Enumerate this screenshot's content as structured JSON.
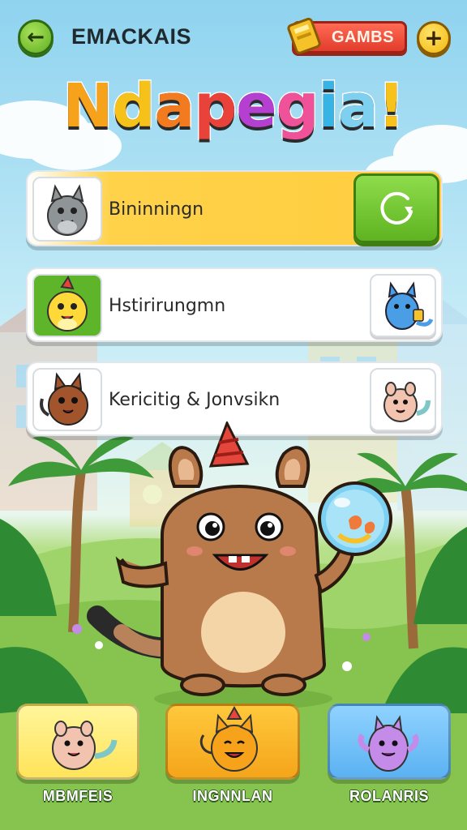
{
  "header": {
    "title": "EMACKAIS",
    "currency_label": "GAMBS",
    "back_icon": "back-arrow-icon",
    "plus_icon": "plus-icon",
    "ticket_icon": "ticket-icon"
  },
  "logo": {
    "letters": [
      "N",
      "d",
      "a",
      "p",
      "e",
      "g",
      "i",
      "a",
      "!"
    ],
    "colors": [
      "#f7a21b",
      "#f6c21a",
      "#f27a1f",
      "#e8423b",
      "#b43fd1",
      "#f0529a",
      "#36b4e6",
      "#7ed0f0",
      "#f7c21b"
    ]
  },
  "cards": [
    {
      "title": "Bininningn",
      "avatar": "gray-creature-avatar",
      "action_icon": "play-circle-icon"
    },
    {
      "title": "Hstirirungmn",
      "avatar": "yellow-creature-avatar",
      "side_avatar": "blue-creature-avatar"
    },
    {
      "title": "Kericitig & Jonvsikn",
      "avatar": "brown-creature-avatar",
      "side_avatar": "pink-creature-avatar"
    }
  ],
  "bottom_nav": [
    {
      "label": "MBMFEIS",
      "icon": "pink-critter-icon"
    },
    {
      "label": "INGNNLAN",
      "icon": "orange-cat-icon"
    },
    {
      "label": "ROLANRIS",
      "icon": "purple-monster-icon"
    }
  ],
  "colors": {
    "accent_green": "#5fb320",
    "accent_yellow": "#ffcd3e",
    "accent_red": "#e23c2c",
    "accent_blue": "#5bb2f2"
  }
}
